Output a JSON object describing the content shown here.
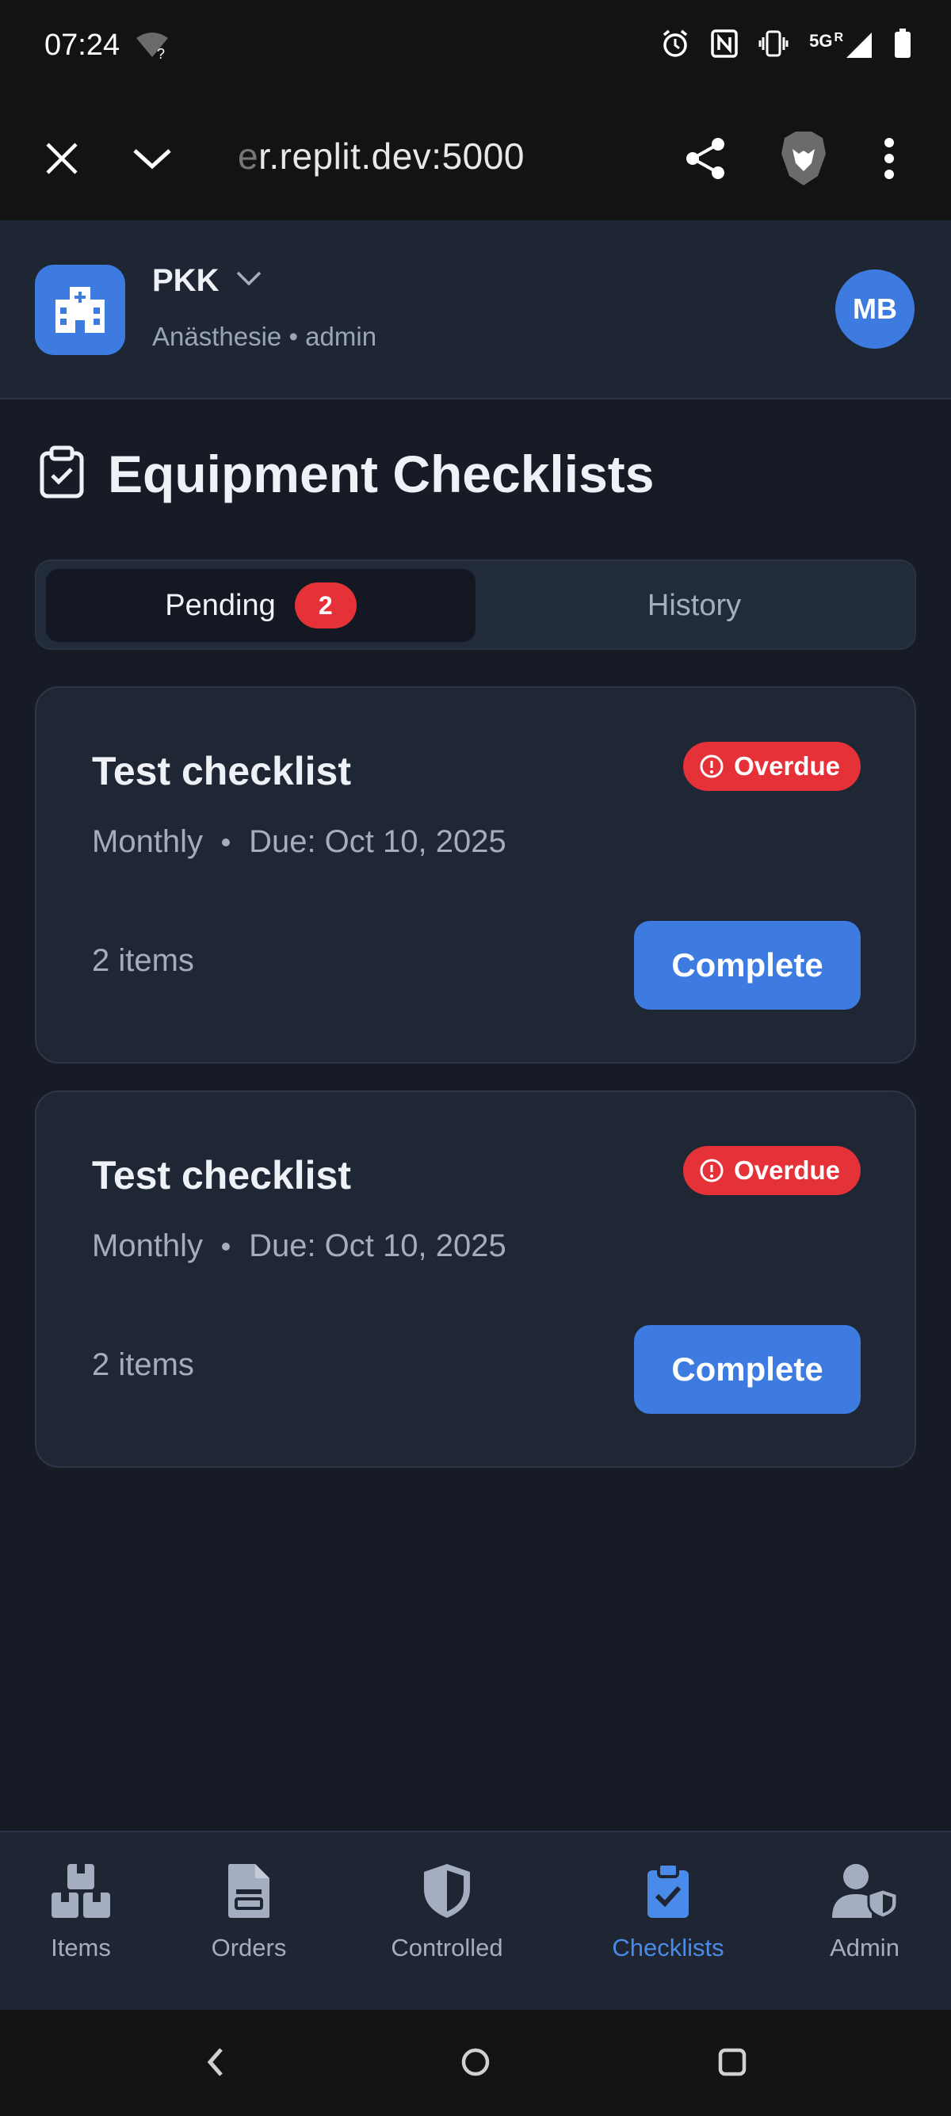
{
  "status_bar": {
    "time": "07:24",
    "network": "5G",
    "roaming": "R"
  },
  "browser": {
    "url_faded": "e",
    "url": "r.replit.dev:5000"
  },
  "header": {
    "org_name": "PKK",
    "org_subtitle": "Anästhesie • admin",
    "avatar_initials": "MB"
  },
  "page": {
    "title": "Equipment Checklists"
  },
  "tabs": [
    {
      "label": "Pending",
      "count": "2",
      "active": true
    },
    {
      "label": "History",
      "active": false
    }
  ],
  "checklists": [
    {
      "title": "Test checklist",
      "status": "Overdue",
      "frequency": "Monthly",
      "due": "Due: Oct 10, 2025",
      "items": "2 items",
      "action": "Complete"
    },
    {
      "title": "Test checklist",
      "status": "Overdue",
      "frequency": "Monthly",
      "due": "Due: Oct 10, 2025",
      "items": "2 items",
      "action": "Complete"
    }
  ],
  "nav": [
    {
      "label": "Items",
      "icon": "boxes-icon",
      "active": false
    },
    {
      "label": "Orders",
      "icon": "document-icon",
      "active": false
    },
    {
      "label": "Controlled",
      "icon": "shield-icon",
      "active": false
    },
    {
      "label": "Checklists",
      "icon": "clipboard-check-icon",
      "active": true
    },
    {
      "label": "Admin",
      "icon": "user-shield-icon",
      "active": false
    }
  ],
  "colors": {
    "accent": "#3d7be0",
    "danger": "#e53238",
    "background": "#161b25",
    "card": "#1f2634"
  }
}
